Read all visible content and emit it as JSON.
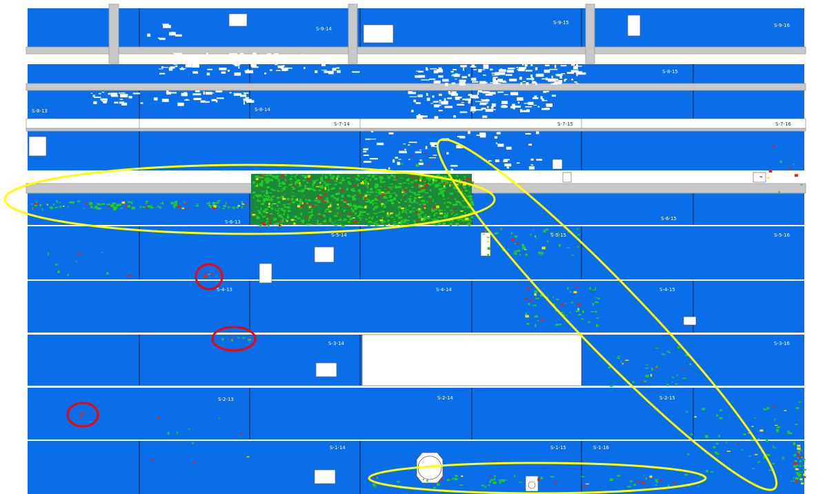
{
  "colors": {
    "panel": "#0a6ee8",
    "gap": "#ffffff",
    "beam": "#c8c8c8",
    "beam_edge": "#9a9a9a",
    "label": "#ffffff",
    "label_dark": "#333333",
    "defect_green": "#22cc22",
    "defect_red": "#dd2222",
    "defect_yellow": "#f2e300",
    "highlight_yellow": "#ffff00",
    "highlight_red": "#ff0000"
  },
  "rows": [
    {
      "id": "row-9",
      "labels": [
        "S-9-14",
        "S-9-15",
        "S-9-16"
      ]
    },
    {
      "id": "row-8-upper",
      "labels": [
        "S-8-15"
      ]
    },
    {
      "id": "row-8-lower",
      "labels": [
        "S-8-13",
        "S-8-14"
      ]
    },
    {
      "id": "row-7",
      "labels": [
        "S-7-14",
        "S-7-15",
        "S-7-16"
      ]
    },
    {
      "id": "row-6",
      "labels": [
        "S-6-13",
        "S-6-15"
      ]
    },
    {
      "id": "row-5",
      "labels": [
        "S-5-14",
        "S-5-15",
        "S-5-16"
      ]
    },
    {
      "id": "row-4",
      "labels": [
        "S-4-13",
        "S-4-14",
        "S-4-15"
      ]
    },
    {
      "id": "row-3",
      "labels": [
        "S-3-14",
        "S-3-16"
      ]
    },
    {
      "id": "row-2",
      "labels": [
        "S-2-13",
        "S-2-14",
        "S-2-15"
      ]
    },
    {
      "id": "row-1",
      "labels": [
        "S-1-14",
        "S-1-15",
        "S-1-16"
      ]
    }
  ],
  "annotations": {
    "yellow_ellipses": 3,
    "red_circles": 3
  }
}
